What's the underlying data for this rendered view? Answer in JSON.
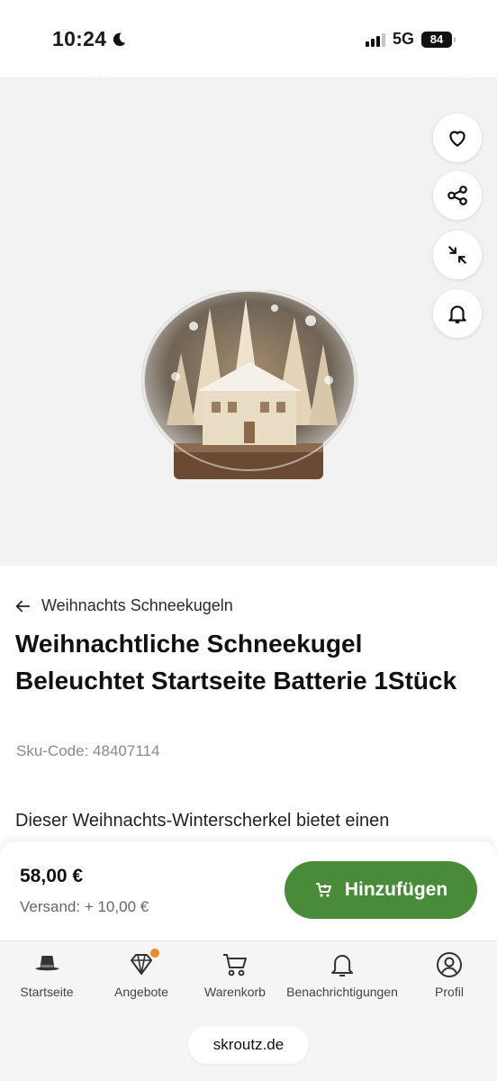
{
  "status_bar": {
    "time": "10:24",
    "network": "5G",
    "battery": "84"
  },
  "product": {
    "breadcrumb": "Weihnachts Schneekugeln",
    "title": "Weihnachtliche Schneekugel Beleuchtet Startseite Batterie 1Stück",
    "sku": "Sku-Code: 48407114",
    "description": "Dieser Weihnachts-Winterscherkel bietet einen"
  },
  "image_actions": {
    "icons": [
      "heart-icon",
      "share-icon",
      "collapse-icon",
      "bell-icon"
    ]
  },
  "purchase": {
    "price": "58,00 €",
    "shipping": "Versand: + 10,00 €",
    "add_label": "Hinzufügen"
  },
  "nav": {
    "items": [
      {
        "label": "Startseite",
        "icon": "hat-icon"
      },
      {
        "label": "Angebote",
        "icon": "diamond-icon"
      },
      {
        "label": "Warenkorb",
        "icon": "cart-icon"
      },
      {
        "label": "Benachrichtigungen",
        "icon": "bell-icon"
      },
      {
        "label": "Profil",
        "icon": "profile-icon"
      }
    ]
  },
  "browser": {
    "domain": "skroutz.de"
  },
  "colors": {
    "accent": "#4a8b3a",
    "badge": "#e88b2c",
    "image_bg": "#f2f2f2"
  }
}
